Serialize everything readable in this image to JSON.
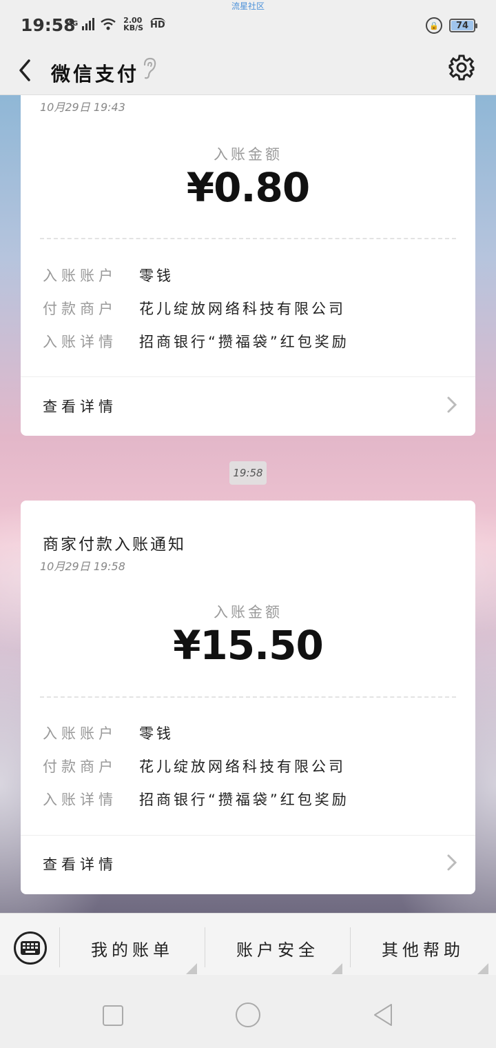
{
  "status_bar": {
    "time": "19:58",
    "network": "4G",
    "speed_value": "2.00",
    "speed_unit": "KB/S",
    "hd": "HD",
    "center_text": "流星社区",
    "battery": "74"
  },
  "nav": {
    "title": "微信支付"
  },
  "cards": [
    {
      "time": "10月29日 19:43",
      "amount_label": "入账金额",
      "amount": "¥0.80",
      "rows": [
        {
          "label": "入账账户",
          "value": "零钱"
        },
        {
          "label": "付款商户",
          "value": "花儿绽放网络科技有限公司"
        },
        {
          "label": "入账详情",
          "value": "招商银行“攒福袋”红包奖励"
        }
      ],
      "detail_link": "查看详情"
    },
    {
      "title": "商家付款入账通知",
      "time": "10月29日 19:58",
      "amount_label": "入账金额",
      "amount": "¥15.50",
      "rows": [
        {
          "label": "入账账户",
          "value": "零钱"
        },
        {
          "label": "付款商户",
          "value": "花儿绽放网络科技有限公司"
        },
        {
          "label": "入账详情",
          "value": "招商银行“攒福袋”红包奖励"
        }
      ],
      "detail_link": "查看详情"
    }
  ],
  "timestamp": "19:58",
  "menu": {
    "items": [
      "我的账单",
      "账户安全",
      "其他帮助"
    ]
  },
  "icons": {
    "back": "back-arrow-icon",
    "settings": "gear-icon",
    "ear": "ear-icon",
    "keyboard": "keyboard-icon",
    "chevron": "chevron-right-icon"
  }
}
